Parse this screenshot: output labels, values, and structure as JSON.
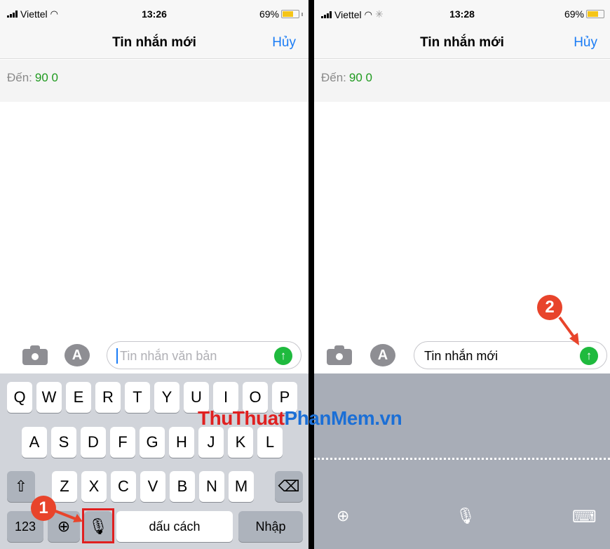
{
  "left": {
    "status": {
      "carrier": "Viettel",
      "time": "13:26",
      "battery": "69%"
    },
    "nav": {
      "title": "Tin nhắn mới",
      "cancel": "Hủy"
    },
    "to": {
      "label": "Đến:",
      "value": "90 0"
    },
    "input": {
      "placeholder": "Tin nhắn văn bản"
    },
    "keyboard": {
      "row1": [
        "Q",
        "W",
        "E",
        "R",
        "T",
        "Y",
        "U",
        "I",
        "O",
        "P"
      ],
      "row2": [
        "A",
        "S",
        "D",
        "F",
        "G",
        "H",
        "J",
        "K",
        "L"
      ],
      "row3": [
        "Z",
        "X",
        "C",
        "V",
        "B",
        "N",
        "M"
      ],
      "numbers_key": "123",
      "space_key": "dấu cách",
      "return_key": "Nhập",
      "shift_icon": "shift-icon",
      "delete_icon": "backspace-icon",
      "globe_icon": "globe-icon",
      "mic_icon": "microphone-icon"
    }
  },
  "right": {
    "status": {
      "carrier": "Viettel",
      "time": "13:28",
      "battery": "69%"
    },
    "nav": {
      "title": "Tin nhắn mới",
      "cancel": "Hủy"
    },
    "to": {
      "label": "Đến:",
      "value": "90 0"
    },
    "input": {
      "value": "Tin nhắn mới"
    },
    "dictation_icons": [
      "globe-icon",
      "microphone-off-icon",
      "keyboard-icon"
    ]
  },
  "annotations": {
    "step1": "1",
    "step2": "2"
  },
  "watermark": {
    "part_a": "ThuThuat",
    "part_b": "PhanMem.vn"
  },
  "colors": {
    "accent_blue": "#1a7cf5",
    "send_green": "#1fba3e",
    "recipient_green": "#1f9a1f",
    "badge_red": "#e8442b"
  }
}
